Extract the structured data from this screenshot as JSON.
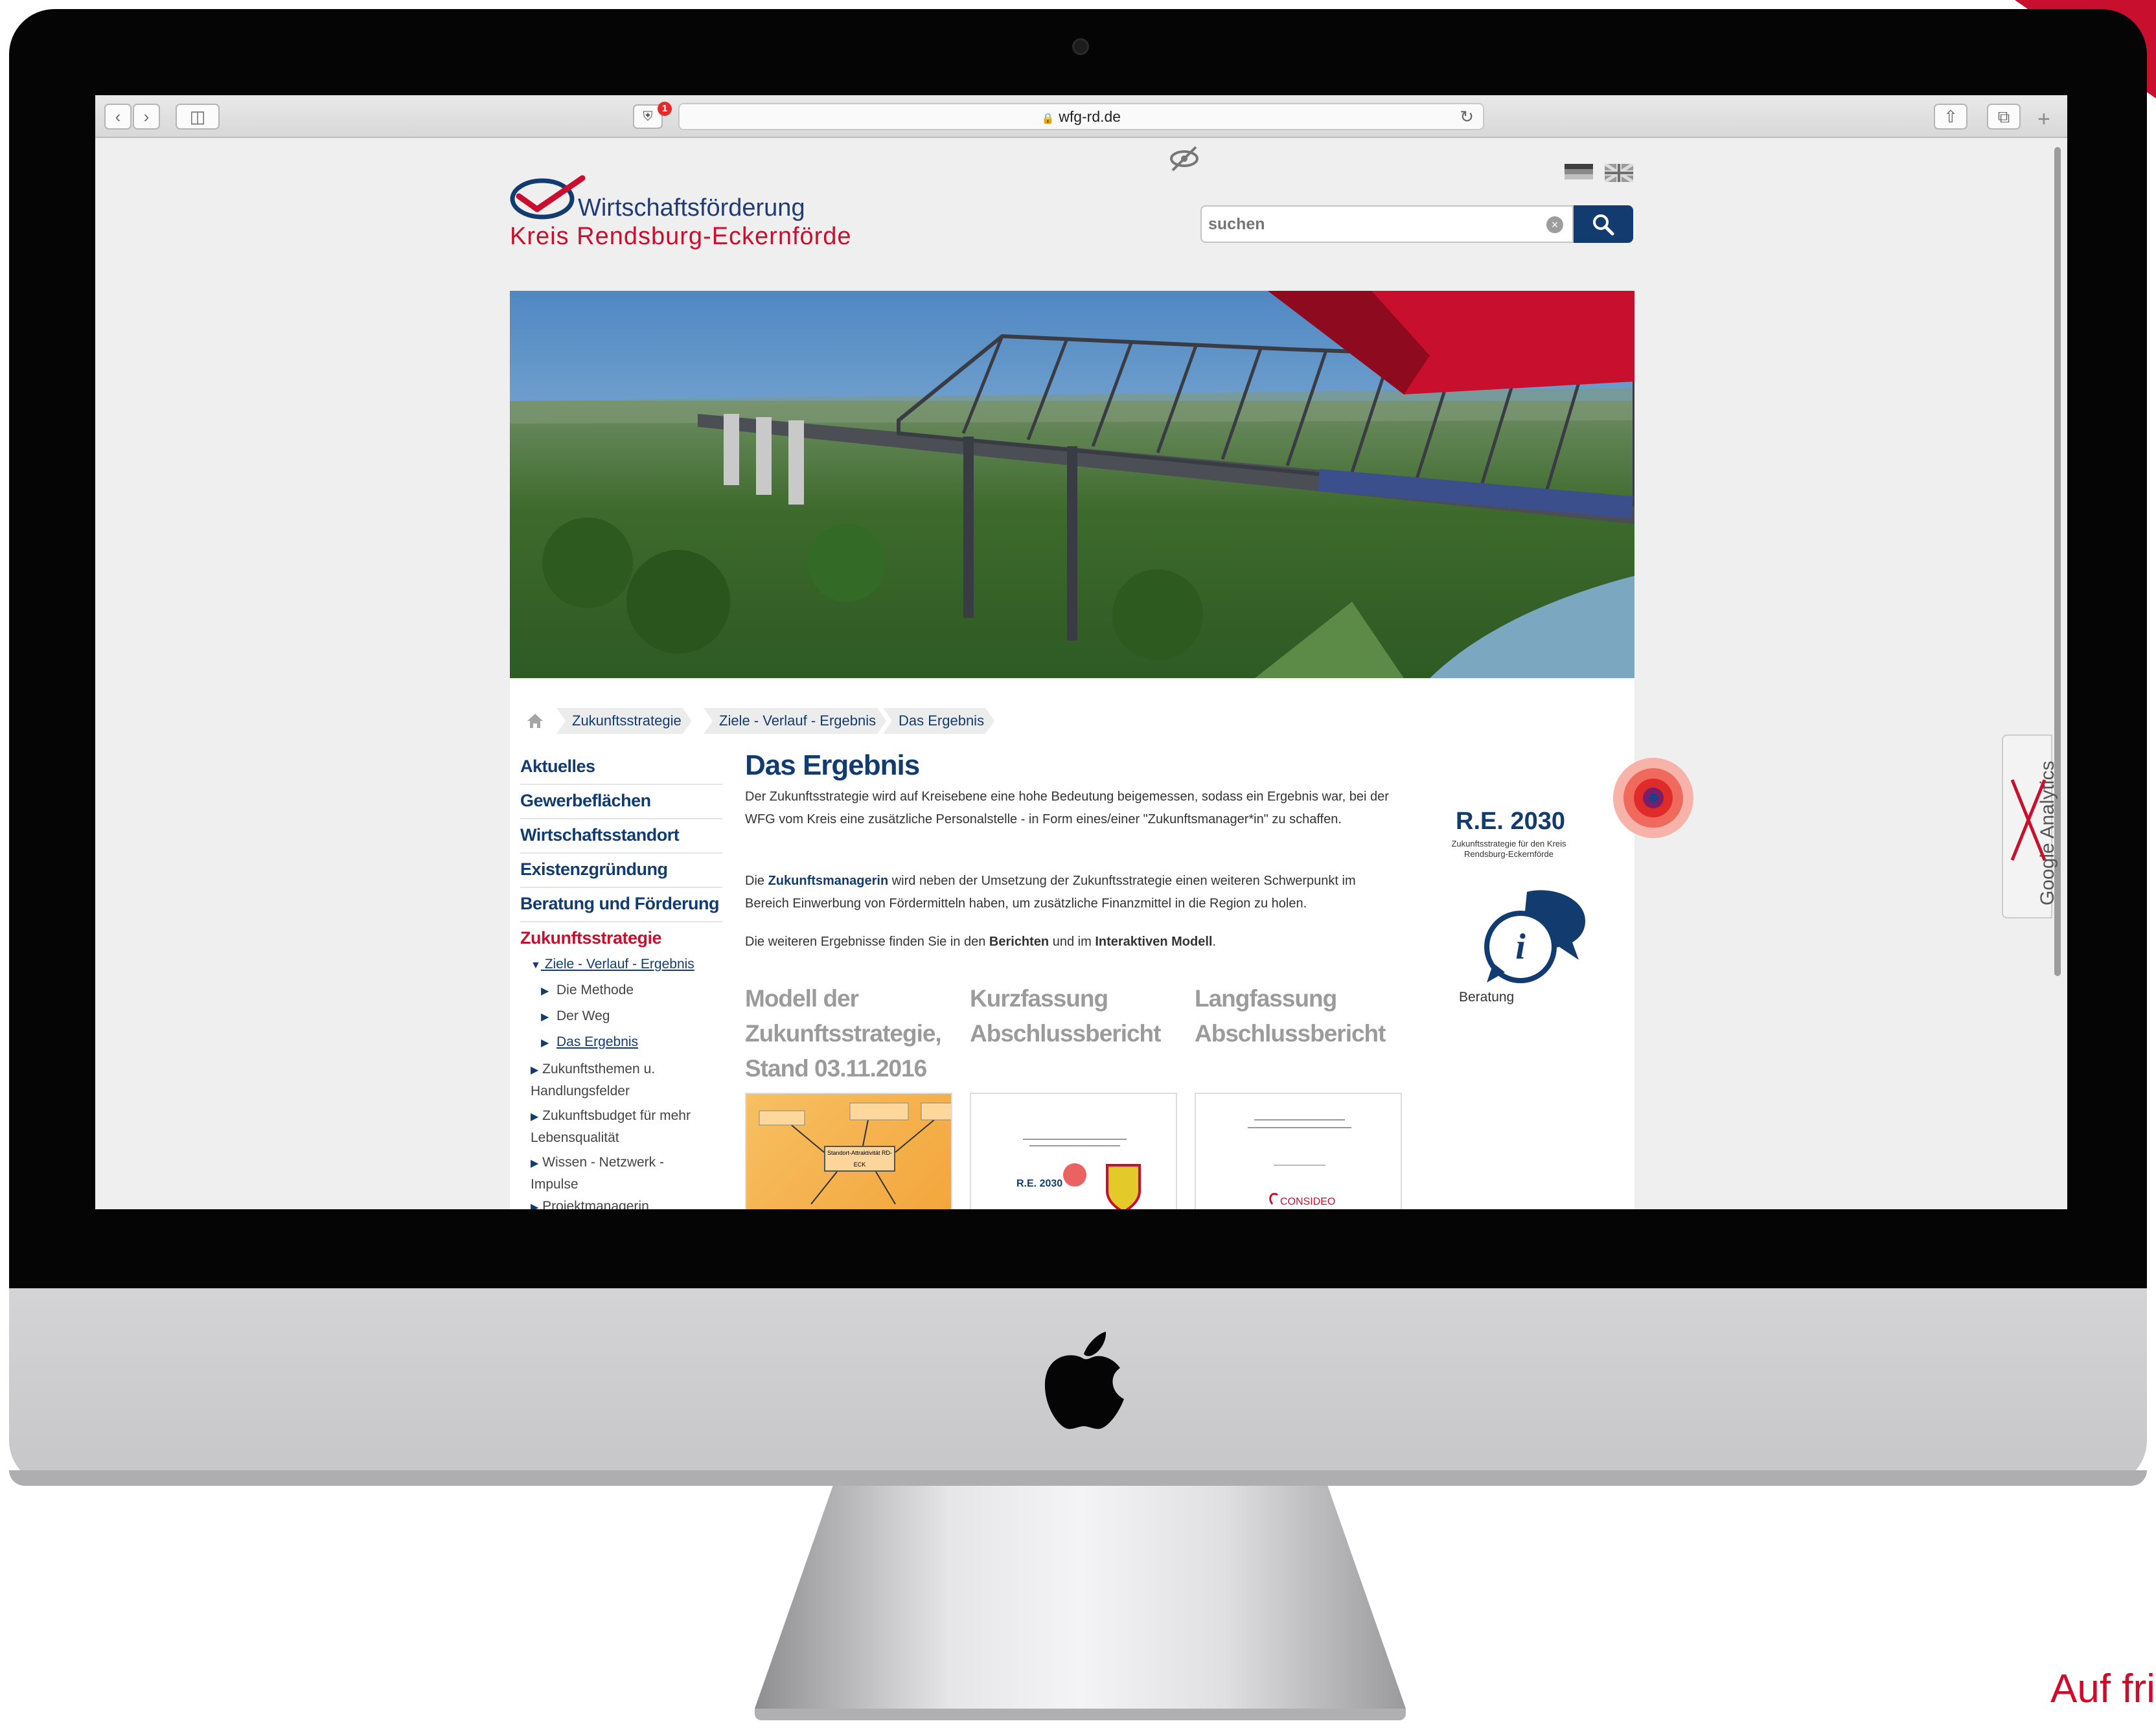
{
  "browser": {
    "url": "wfg-rd.de",
    "shield_badge": "1"
  },
  "site": {
    "logo_line1": "Wirtschaftsförderung",
    "logo_line2": "Kreis Rendsburg-Eckernförde",
    "search_placeholder": "suchen"
  },
  "breadcrumb": [
    "Zukunftsstrategie",
    "Ziele - Verlauf - Ergebnis",
    "Das Ergebnis"
  ],
  "sidebar": {
    "items": [
      "Aktuelles",
      "Gewerbeflächen",
      "Wirtschaftsstandort",
      "Existenzgründung",
      "Beratung und Förderung",
      "Zukunftsstrategie"
    ],
    "sub_open": "Ziele - Verlauf - Ergebnis",
    "sub_children": [
      "Die Methode",
      "Der Weg",
      "Das Ergebnis"
    ],
    "siblings": [
      "Zukunftsthemen u. Handlungsfelder",
      "Zukunftsbudget für mehr Lebensqualität",
      "Wissen - Netzwerk - Impulse",
      "Projektmanagerin"
    ]
  },
  "article": {
    "title": "Das Ergebnis",
    "p1": "Der Zukunftsstrategie wird auf Kreisebene eine hohe Bedeutung beigemessen, sodass ein Ergebnis war, bei der WFG vom Kreis eine zusätzliche Personalstelle - in Form eines/einer \"Zukunftsmanager*in\" zu schaffen.",
    "p2_bold": "Zukunftsmanagerin",
    "p2_a": "Die ",
    "p2_b": " wird neben der Umsetzung der Zukunftsstrategie einen weiteren Schwerpunkt im Bereich Einwerbung von Fördermitteln haben, um zusätzliche Finanzmittel in die Region zu holen.",
    "p3_a": "Die weiteren Ergebnisse finden Sie in den ",
    "p3_bold1": "Berichten",
    "p3_b": " und im ",
    "p3_bold2": "Interaktiven Modell",
    "p3_c": "."
  },
  "docs": [
    {
      "title": "Modell der Zukunftsstrategie, Stand 03.11.2016"
    },
    {
      "title": "Kurzfassung Abschlussbericht"
    },
    {
      "title": "Langfassung Abschlussbericht"
    }
  ],
  "doc_thumb_text": {
    "model_center": "Standort-Attraktivität RD-ECK",
    "consideo": "CONSIDEO",
    "re_small": "R.E. 2030"
  },
  "right_col": {
    "re_title": "R.E. 2030",
    "re_sub": "Zukunftsstrategie für den Kreis Rendsburg-Eckernförde",
    "beratung": "Beratung"
  },
  "google_analytics_tab": "Google Analytics",
  "tagline": "Auf fri",
  "colors": {
    "brand_blue": "#123c70",
    "brand_red": "#c8102e"
  }
}
